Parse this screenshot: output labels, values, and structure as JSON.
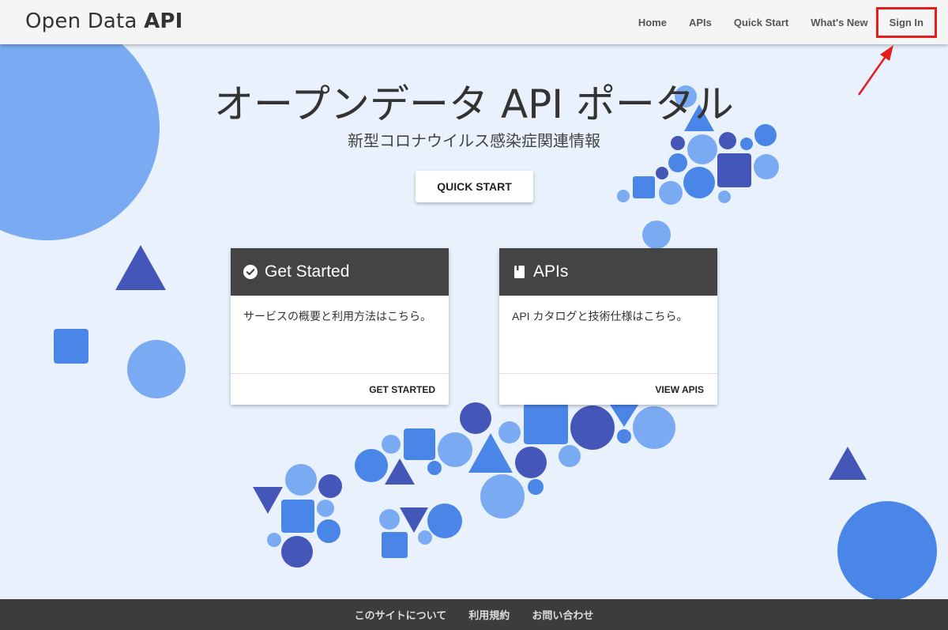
{
  "brand": {
    "name_regular": "Open Data ",
    "name_bold": "API"
  },
  "nav": [
    {
      "label": "Home"
    },
    {
      "label": "APIs"
    },
    {
      "label": "Quick Start"
    },
    {
      "label": "What's New"
    },
    {
      "label": "Sign In"
    }
  ],
  "hero": {
    "title": "オープンデータ API ポータル",
    "subtitle": "新型コロナウイルス感染症関連情報",
    "button": "QUICK START"
  },
  "cards": [
    {
      "icon": "check-circle-icon",
      "title": "Get Started",
      "body": "サービスの概要と利用方法はこちら。",
      "action": "GET STARTED"
    },
    {
      "icon": "book-icon",
      "title": "APIs",
      "body": "API カタログと技術仕様はこちら。",
      "action": "VIEW APIS"
    }
  ],
  "footer": [
    {
      "label": "このサイトについて"
    },
    {
      "label": "利用規約"
    },
    {
      "label": "お問い合わせ"
    }
  ],
  "colors": {
    "background": "#e8f1fc",
    "header": "#f5f5f5",
    "card_header": "#444444",
    "footer": "#3c3c3c",
    "shape_light": "#7aaaf2",
    "shape_mid": "#4a86e8",
    "shape_dark": "#4456b8",
    "highlight": "#e21e1e"
  }
}
